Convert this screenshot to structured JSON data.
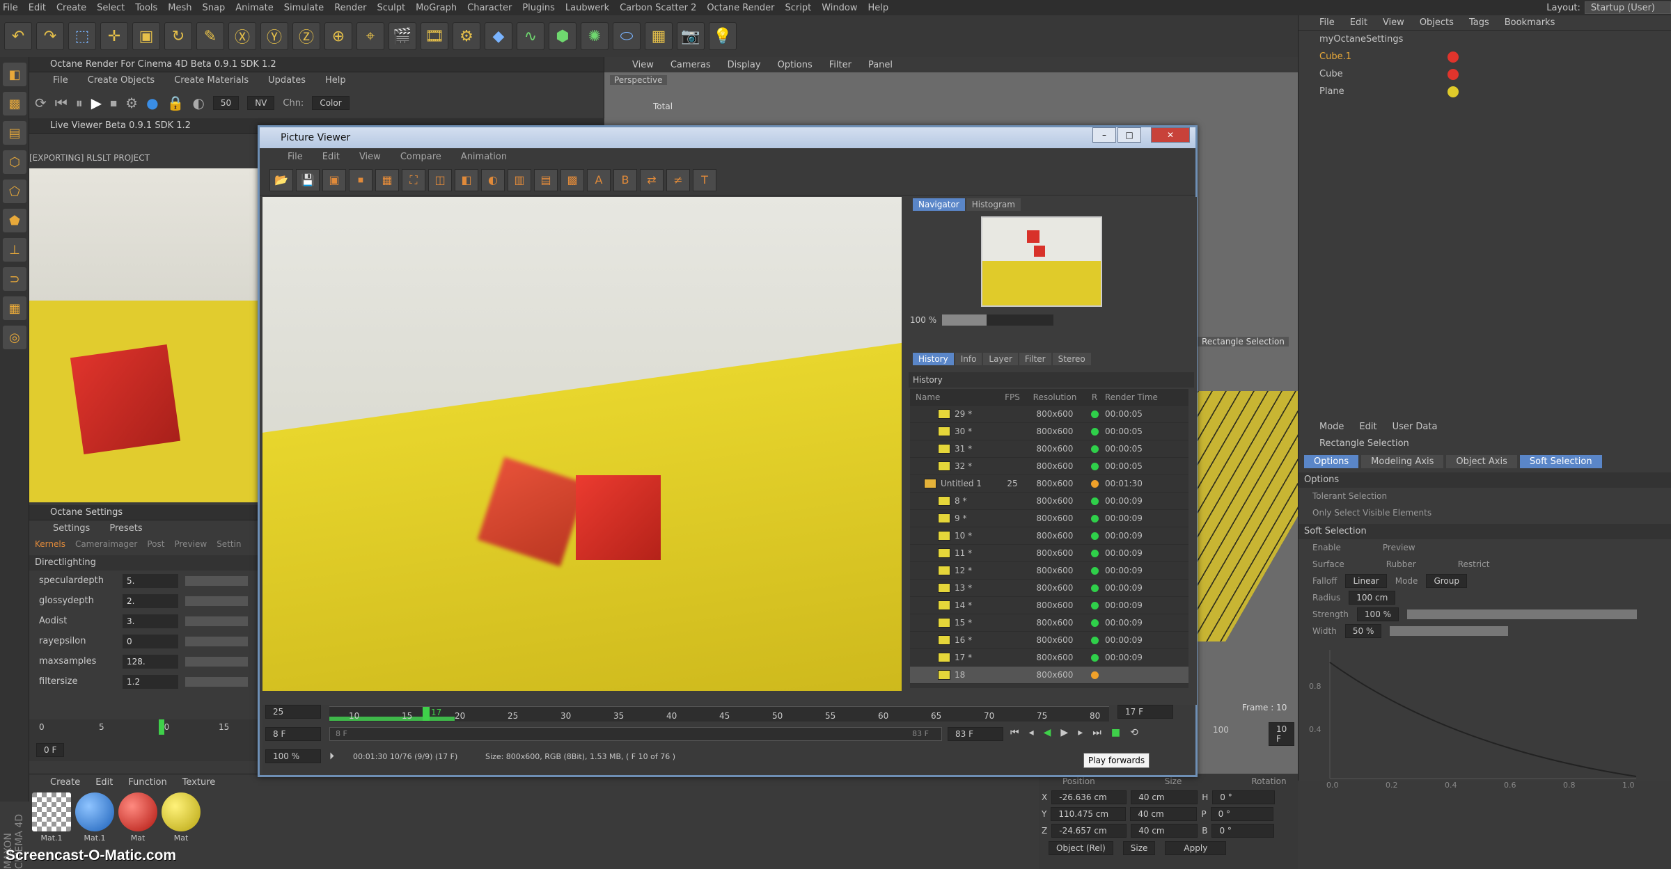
{
  "menubar": {
    "items": [
      "File",
      "Edit",
      "Create",
      "Select",
      "Tools",
      "Mesh",
      "Snap",
      "Animate",
      "Simulate",
      "Render",
      "Sculpt",
      "MoGraph",
      "Character",
      "Plugins",
      "Laubwerk",
      "Carbon Scatter 2",
      "Octane Render",
      "Script",
      "Window",
      "Help"
    ],
    "layout_label": "Layout:",
    "layout_value": "Startup (User)"
  },
  "octane_panel": {
    "title": "Octane Render For Cinema 4D Beta 0.9.1 SDK 1.2",
    "menu": [
      "File",
      "Create Objects",
      "Create Materials",
      "Updates",
      "Help"
    ],
    "samples": "50",
    "nv": "NV",
    "chn_label": "Chn:",
    "chn_value": "Color",
    "live_viewer": "Live Viewer Beta 0.9.1 SDK 1.2",
    "exporting": "[EXPORTING] RLSLT PROJECT"
  },
  "viewport": {
    "menu": [
      "View",
      "Cameras",
      "Display",
      "Options",
      "Filter",
      "Panel"
    ],
    "perspective": "Perspective",
    "total": "Total",
    "rect_label": "Rectangle Selection"
  },
  "object_manager": {
    "menu": [
      "File",
      "Edit",
      "View",
      "Objects",
      "Tags",
      "Bookmarks"
    ],
    "objects": [
      {
        "name": "myOctaneSettings",
        "color": "#c8c8c8"
      },
      {
        "name": "Cube.1",
        "color": "#e8a93a",
        "tag": "#e0342c"
      },
      {
        "name": "Cube",
        "color": "#c8c8c8",
        "tag": "#e0342c"
      },
      {
        "name": "Plane",
        "color": "#c8c8c8",
        "tag": "#e0cb2a"
      }
    ]
  },
  "attributes": {
    "menu": [
      "Mode",
      "Edit",
      "User Data"
    ],
    "title": "Rectangle Selection",
    "tabs": [
      "Options",
      "Modeling Axis",
      "Object Axis",
      "Soft Selection"
    ],
    "options_header": "Options",
    "tolerant": "Tolerant Selection",
    "only_visible": "Only Select Visible Elements",
    "soft_header": "Soft Selection",
    "enable": "Enable",
    "preview": "Preview",
    "surface": "Surface",
    "rubber": "Rubber",
    "restrict": "Restrict",
    "falloff": "Falloff",
    "falloff_value": "Linear",
    "mode": "Mode",
    "mode_value": "Group",
    "radius": "Radius",
    "radius_value": "100 cm",
    "strength": "Strength",
    "strength_value": "100 %",
    "width": "Width",
    "width_value": "50 %",
    "curve_y": [
      "0.8",
      "0.4"
    ],
    "curve_x": [
      "0.0",
      "0.2",
      "0.4",
      "0.6",
      "0.8",
      "1.0"
    ]
  },
  "octane_settings": {
    "title": "Octane Settings",
    "menu": [
      "Settings",
      "Presets"
    ],
    "tabs": [
      "Kernels",
      "Cameraimager",
      "Post",
      "Preview",
      "Settin"
    ],
    "kernel": "Directlighting",
    "params": [
      {
        "name": "speculardepth",
        "value": "5."
      },
      {
        "name": "glossydepth",
        "value": "2."
      },
      {
        "name": "Aodist",
        "value": "3."
      },
      {
        "name": "rayepsilon",
        "value": "0"
      },
      {
        "name": "maxsamples",
        "value": "128."
      },
      {
        "name": "filtersize",
        "value": "1.2"
      }
    ]
  },
  "main_timeline": {
    "ticks": [
      "0",
      "5",
      "10",
      "15"
    ],
    "frame": "0 F",
    "frame_right": "10 F",
    "frame_right_num": "100"
  },
  "material_panel": {
    "menu": [
      "Create",
      "Edit",
      "Function",
      "Texture"
    ],
    "materials": [
      {
        "name": "Mat.1",
        "color": "#ddd"
      },
      {
        "name": "Mat.1",
        "color": "#2a7fd8"
      },
      {
        "name": "Mat",
        "color": "#d8322a"
      },
      {
        "name": "Mat",
        "color": "#d8cc2a"
      }
    ]
  },
  "coords": {
    "headers": [
      "Position",
      "Size",
      "Rotation"
    ],
    "rows": [
      {
        "axis": "X",
        "pos": "-26.636 cm",
        "size": "40 cm",
        "rlabel": "H",
        "rot": "0 °"
      },
      {
        "axis": "Y",
        "pos": "110.475 cm",
        "size": "40 cm",
        "rlabel": "P",
        "rot": "0 °"
      },
      {
        "axis": "Z",
        "pos": "-24.657 cm",
        "size": "40 cm",
        "rlabel": "B",
        "rot": "0 °"
      }
    ],
    "obj_mode": "Object (Rel)",
    "size_mode": "Size",
    "apply": "Apply"
  },
  "picture_viewer": {
    "title": "Picture Viewer",
    "menu": [
      "File",
      "Edit",
      "View",
      "Compare",
      "Animation"
    ],
    "nav_tabs": [
      "Navigator",
      "Histogram"
    ],
    "zoom": "100 %",
    "tabs": [
      "History",
      "Info",
      "Layer",
      "Filter",
      "Stereo"
    ],
    "history_label": "History",
    "columns": [
      "Name",
      "FPS",
      "Resolution",
      "R",
      "Render Time"
    ],
    "rows": [
      {
        "name": "29 *",
        "fps": "",
        "res": "800x600",
        "dot": "#2fd04a",
        "time": "00:00:05"
      },
      {
        "name": "30 *",
        "fps": "",
        "res": "800x600",
        "dot": "#2fd04a",
        "time": "00:00:05"
      },
      {
        "name": "31 *",
        "fps": "",
        "res": "800x600",
        "dot": "#2fd04a",
        "time": "00:00:05"
      },
      {
        "name": "32 *",
        "fps": "",
        "res": "800x600",
        "dot": "#2fd04a",
        "time": "00:00:05"
      },
      {
        "name": "Untitled 1",
        "fps": "25",
        "res": "800x600",
        "dot": "#f0a12a",
        "time": "00:01:30",
        "folder": true
      },
      {
        "name": "8 *",
        "fps": "",
        "res": "800x600",
        "dot": "#2fd04a",
        "time": "00:00:09"
      },
      {
        "name": "9 *",
        "fps": "",
        "res": "800x600",
        "dot": "#2fd04a",
        "time": "00:00:09"
      },
      {
        "name": "10 *",
        "fps": "",
        "res": "800x600",
        "dot": "#2fd04a",
        "time": "00:00:09"
      },
      {
        "name": "11 *",
        "fps": "",
        "res": "800x600",
        "dot": "#2fd04a",
        "time": "00:00:09"
      },
      {
        "name": "12 *",
        "fps": "",
        "res": "800x600",
        "dot": "#2fd04a",
        "time": "00:00:09"
      },
      {
        "name": "13 *",
        "fps": "",
        "res": "800x600",
        "dot": "#2fd04a",
        "time": "00:00:09"
      },
      {
        "name": "14 *",
        "fps": "",
        "res": "800x600",
        "dot": "#2fd04a",
        "time": "00:00:09"
      },
      {
        "name": "15 *",
        "fps": "",
        "res": "800x600",
        "dot": "#2fd04a",
        "time": "00:00:09"
      },
      {
        "name": "16 *",
        "fps": "",
        "res": "800x600",
        "dot": "#2fd04a",
        "time": "00:00:09"
      },
      {
        "name": "17 *",
        "fps": "",
        "res": "800x600",
        "dot": "#2fd04a",
        "time": "00:00:09"
      },
      {
        "name": "18",
        "fps": "",
        "res": "800x600",
        "dot": "#f0a12a",
        "time": "",
        "selected": true
      }
    ],
    "fps_field": "25",
    "timeline_ticks": [
      "10",
      "15",
      "20",
      "25",
      "30",
      "35",
      "40",
      "45",
      "50",
      "55",
      "60",
      "65",
      "70",
      "75",
      "80"
    ],
    "current_frame": "17",
    "end_field": "17 F",
    "start_field": "8 F",
    "range_start": "8 F",
    "range_end": "83 F",
    "range_end2": "83 F",
    "zoom_field": "100 %",
    "status_time": "00:01:30 10/76 (9/9) (17 F)",
    "status_info": "Size: 800x600, RGB (8Bit), 1.53 MB, ( F 10 of 76 )",
    "frame_label": "Frame : 10",
    "tooltip": "Play forwards"
  },
  "watermark": "Screencast-O-Matic.com",
  "maxon": "MAXON CINEMA 4D"
}
